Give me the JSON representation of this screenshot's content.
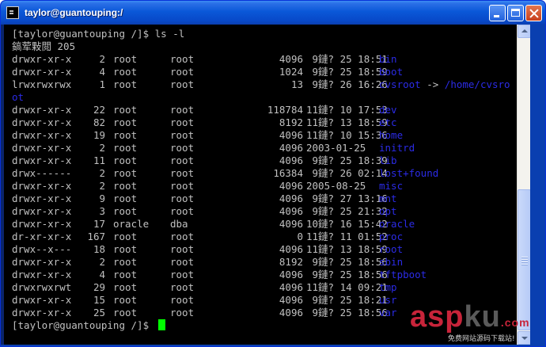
{
  "window": {
    "title": "taylor@guantouping:/"
  },
  "terminal": {
    "command_line": "[taylor@guantouping /]$ ls -l",
    "total_line": "鎬荤敤閲 205",
    "entries": [
      {
        "perm": "drwxr-xr-x",
        "links": "2",
        "owner": "root",
        "group": "root",
        "size": "4096",
        "date": " 9鏈? 25 18:51",
        "name": "bin"
      },
      {
        "perm": "drwxr-xr-x",
        "links": "4",
        "owner": "root",
        "group": "root",
        "size": "1024",
        "date": " 9鏈? 25 18:59",
        "name": "boot"
      },
      {
        "perm": "lrwxrwxrwx",
        "links": "1",
        "owner": "root",
        "group": "root",
        "size": "13",
        "date": " 9鏈? 26 16:26",
        "name": "cvsroot",
        "arrow": " -> ",
        "target": "/home/cvsro",
        "wrap": "ot"
      },
      {
        "perm": "drwxr-xr-x",
        "links": "22",
        "owner": "root",
        "group": "root",
        "size": "118784",
        "date": "11鏈? 10 17:53",
        "name": "dev"
      },
      {
        "perm": "drwxr-xr-x",
        "links": "82",
        "owner": "root",
        "group": "root",
        "size": "8192",
        "date": "11鏈? 13 18:59",
        "name": "etc"
      },
      {
        "perm": "drwxr-xr-x",
        "links": "19",
        "owner": "root",
        "group": "root",
        "size": "4096",
        "date": "11鏈? 10 15:36",
        "name": "home"
      },
      {
        "perm": "drwxr-xr-x",
        "links": "2",
        "owner": "root",
        "group": "root",
        "size": "4096",
        "date": "2003-01-25",
        "name": "initrd"
      },
      {
        "perm": "drwxr-xr-x",
        "links": "11",
        "owner": "root",
        "group": "root",
        "size": "4096",
        "date": " 9鏈? 25 18:39",
        "name": "lib"
      },
      {
        "perm": "drwx------",
        "links": "2",
        "owner": "root",
        "group": "root",
        "size": "16384",
        "date": " 9鏈? 26 02:14",
        "name": "lost+found"
      },
      {
        "perm": "drwxr-xr-x",
        "links": "2",
        "owner": "root",
        "group": "root",
        "size": "4096",
        "date": "2005-08-25",
        "name": "misc"
      },
      {
        "perm": "drwxr-xr-x",
        "links": "9",
        "owner": "root",
        "group": "root",
        "size": "4096",
        "date": " 9鏈? 27 13:16",
        "name": "mnt"
      },
      {
        "perm": "drwxr-xr-x",
        "links": "3",
        "owner": "root",
        "group": "root",
        "size": "4096",
        "date": " 9鏈? 25 21:32",
        "name": "opt"
      },
      {
        "perm": "drwxr-xr-x",
        "links": "17",
        "owner": "oracle",
        "group": "dba",
        "size": "4096",
        "date": "10鏈? 16 15:42",
        "name": "oracle"
      },
      {
        "perm": "dr-xr-xr-x",
        "links": "167",
        "owner": "root",
        "group": "root",
        "size": "0",
        "date": "11鏈? 11 01:52",
        "name": "proc"
      },
      {
        "perm": "drwx--x---",
        "links": "18",
        "owner": "root",
        "group": "root",
        "size": "4096",
        "date": "11鏈? 13 18:59",
        "name": "root"
      },
      {
        "perm": "drwxr-xr-x",
        "links": "2",
        "owner": "root",
        "group": "root",
        "size": "8192",
        "date": " 9鏈? 25 18:56",
        "name": "sbin"
      },
      {
        "perm": "drwxr-xr-x",
        "links": "4",
        "owner": "root",
        "group": "root",
        "size": "4096",
        "date": " 9鏈? 25 18:56",
        "name": "tftpboot"
      },
      {
        "perm": "drwxrwxrwt",
        "links": "29",
        "owner": "root",
        "group": "root",
        "size": "4096",
        "date": "11鏈? 14 09:21",
        "name": "tmp"
      },
      {
        "perm": "drwxr-xr-x",
        "links": "15",
        "owner": "root",
        "group": "root",
        "size": "4096",
        "date": " 9鏈? 25 18:21",
        "name": "usr"
      },
      {
        "perm": "drwxr-xr-x",
        "links": "25",
        "owner": "root",
        "group": "root",
        "size": "4096",
        "date": " 9鏈? 25 18:56",
        "name": "var"
      }
    ],
    "prompt": "[taylor@guantouping /]$ "
  },
  "watermark": {
    "brand_asp": "asp",
    "brand_ku": "ku",
    "brand_tld": ".com",
    "tagline": "免费网站源码下载站!"
  },
  "colors": {
    "terminal_bg": "#000000",
    "terminal_fg": "#c0c0c0",
    "directory_name": "#2b2be6",
    "cursor": "#00ff00",
    "titlebar": "#0a58d8"
  },
  "icons": [
    "terminal-app-icon",
    "minimize-icon",
    "maximize-icon",
    "close-icon"
  ]
}
